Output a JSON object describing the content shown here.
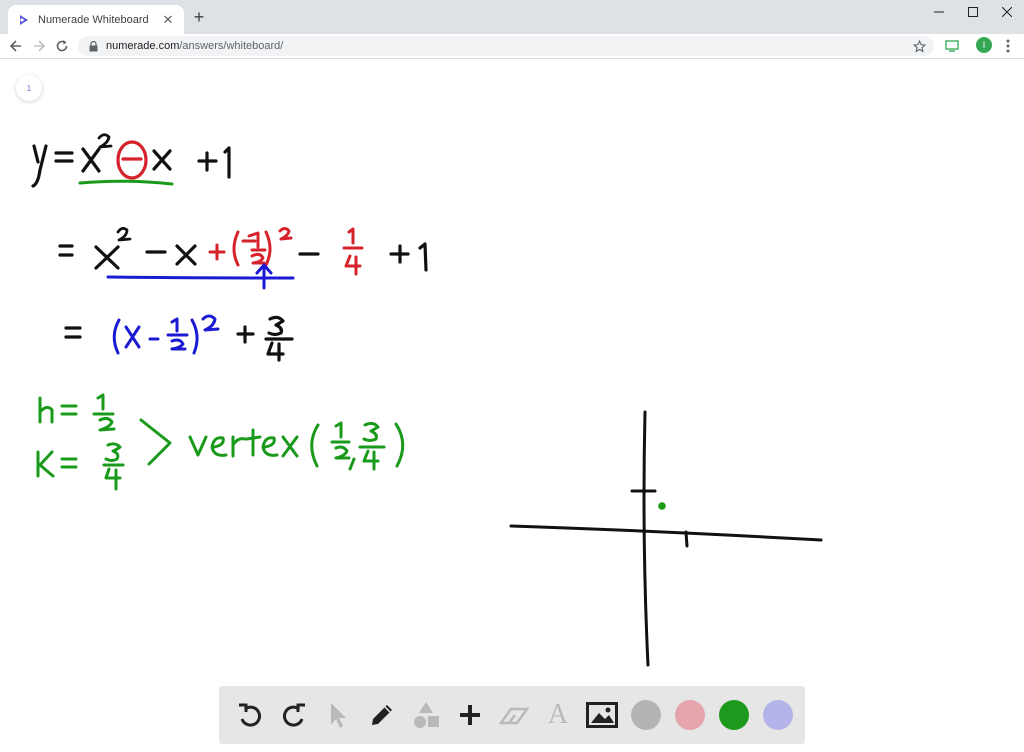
{
  "browser": {
    "tab_title": "Numerade Whiteboard",
    "new_tab_symbol": "+",
    "close_symbol": "✕",
    "url_domain": "numerade.com",
    "url_path": "/answers/whiteboard/",
    "profile_initial": "I"
  },
  "page": {
    "page_number": "1"
  },
  "whiteboard": {
    "ink_colors": {
      "black": "#111111",
      "red": "#d6222a",
      "blue": "#1b1bd3",
      "green": "#1a9a1a"
    }
  },
  "toolbar": {
    "tools": [
      {
        "name": "undo-icon"
      },
      {
        "name": "redo-icon"
      },
      {
        "name": "pointer-icon"
      },
      {
        "name": "pen-icon"
      },
      {
        "name": "shapes-icon"
      },
      {
        "name": "add-icon"
      },
      {
        "name": "eraser-icon"
      },
      {
        "name": "text-icon",
        "glyph": "A"
      },
      {
        "name": "image-icon"
      }
    ],
    "colors": [
      "#b4b4b4",
      "#e6a4ac",
      "#1d9a1d",
      "#b4b4ea"
    ]
  }
}
